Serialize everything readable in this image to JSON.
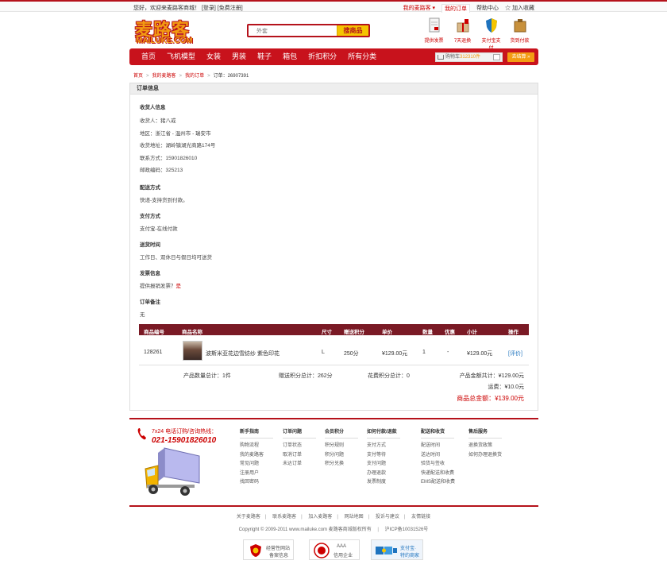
{
  "topbar": {
    "welcome": "您好，欢迎来麦路客商城！",
    "login": "[登录]",
    "register": "[免费注册]",
    "my_mailuke": "我的麦路客 ▾",
    "my_orders": "我的订单",
    "help": "帮助中心",
    "favorite": "☆ 加入收藏"
  },
  "header": {
    "logo_cn": "麦路客",
    "logo_en": "MAILUKE.COM",
    "search_placeholder": "外套",
    "search_button": "搜商品",
    "services": [
      {
        "label": "提供发票",
        "icon": "invoice-icon"
      },
      {
        "label": "7天退换",
        "icon": "gift-box-icon"
      },
      {
        "label": "支付宝支付",
        "icon": "shield-icon"
      },
      {
        "label": "货到付款",
        "icon": "package-icon"
      }
    ]
  },
  "nav": {
    "items": [
      "首页",
      "飞机模型",
      "女装",
      "男装",
      "鞋子",
      "箱包",
      "折扣积分",
      "所有分类"
    ],
    "cart_prefix": "购物车",
    "cart_count": "312310件",
    "checkout": "去结算 »"
  },
  "breadcrumb": {
    "home": "首页",
    "my": "我的麦路客",
    "orders": "我的订单",
    "order_no": "订单：26907391"
  },
  "order": {
    "title": "订单信息",
    "consignee_title": "收货人信息",
    "consignee_name": "收货人：猪八戒",
    "consignee_area": "地区：浙江省 - 温州市 - 瑞安市",
    "consignee_addr": "收货地址：湖岭镇湖光商路174号",
    "consignee_phone": "联系方式：15901826010",
    "consignee_zip": "邮政编码：325213",
    "shipping_title": "配送方式",
    "shipping_value": "快递-支持货到付款。",
    "payment_title": "支付方式",
    "payment_value": "支付宝-在线付款",
    "delivery_title": "送货时间",
    "delivery_value": "工作日、双休日与假日均可送货",
    "invoice_title": "发票信息",
    "invoice_label": "提供报销发票？",
    "invoice_value": "是",
    "remark_title": "订单备注",
    "remark_value": "无"
  },
  "items_table": {
    "headers": [
      "商品编号",
      "商品名称",
      "尺寸",
      "赠送积分",
      "单价",
      "数量",
      "优惠",
      "小计",
      "操作"
    ],
    "rows": [
      {
        "id": "128261",
        "name": "波斯米亚花边雪纺纱 紫色印花",
        "size": "L",
        "points": "250分",
        "price": "¥129.00元",
        "qty": "1",
        "discount": "-",
        "subtotal": "¥129.00元",
        "action": "[评价]"
      }
    ],
    "summary_qty": "产品数量总计：1件",
    "summary_points": "赠送积分总计：262分",
    "summary_spent": "花费积分总计：0",
    "summary_goods": "产品金额共计：¥129.00元",
    "summary_freight": "运费：¥10.0元",
    "summary_total": "商品总金额：¥139.00元"
  },
  "footer": {
    "hotline_label": "7x24 电话订购/咨询热线：",
    "hotline_number": "021-15901826010",
    "columns": [
      {
        "title": "新手指南",
        "items": [
          "购物流程",
          "我的麦路客",
          "常见问题",
          "注册用户",
          "找回密码"
        ]
      },
      {
        "title": "订单问题",
        "items": [
          "订单状态",
          "取消订单",
          "未达订单"
        ]
      },
      {
        "title": "会员积分",
        "items": [
          "积分规则",
          "积分问题",
          "积分兑换"
        ]
      },
      {
        "title": "如何付款/退款",
        "items": [
          "支付方式",
          "支付等待",
          "支付问题",
          "办理退款",
          "发票制度"
        ]
      },
      {
        "title": "配送和收货",
        "items": [
          "配送时间",
          "送达时间",
          "验货与签收",
          "快递配送和收费",
          "EMS配送和收费"
        ]
      },
      {
        "title": "售后服务",
        "items": [
          "退换货政策",
          "如何办理退换货"
        ]
      }
    ],
    "links": [
      "关于麦路客",
      "联系麦路客",
      "加入麦路客",
      "网站地图",
      "投诉与建议",
      "友情链接"
    ],
    "copyright": "Copyright © 2009-2011 www.mailuke.com 麦路客商城版权所有",
    "icp": "沪ICP备10031526号",
    "badges": [
      {
        "line1": "经营性网站",
        "line2": "备案信息"
      },
      {
        "line1": "AAA",
        "line2": "信用企业"
      },
      {
        "line1": "支付宝·",
        "line2": "特约商家"
      }
    ]
  }
}
